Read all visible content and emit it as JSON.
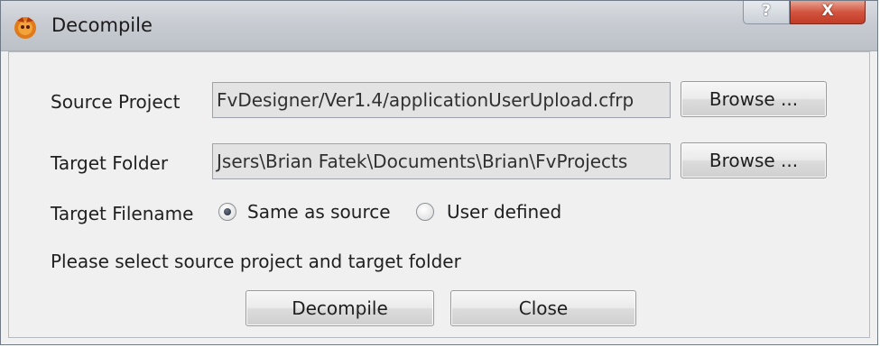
{
  "window": {
    "title": "Decompile",
    "help_glyph": "?",
    "close_glyph": "X"
  },
  "form": {
    "source_label": "Source Project",
    "source_value": "FvDesigner/Ver1.4/applicationUserUpload.cfrp",
    "source_browse": "Browse ...",
    "target_label": "Target Folder",
    "target_value": "Jsers\\Brian Fatek\\Documents\\Brian\\FvProjects",
    "target_browse": "Browse ...",
    "filename_label": "Target Filename",
    "options": {
      "same_as_source": "Same as source",
      "user_defined": "User defined",
      "selected": "same_as_source"
    },
    "status": "Please select source project and target folder"
  },
  "actions": {
    "decompile": "Decompile",
    "close": "Close"
  },
  "icons": [
    "app-icon",
    "help-icon",
    "close-icon"
  ]
}
